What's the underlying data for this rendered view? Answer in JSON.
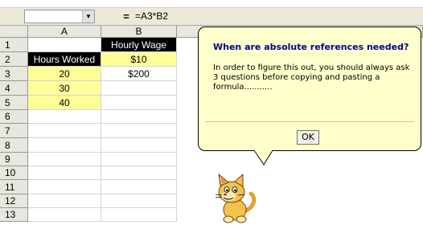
{
  "formula_bar": {
    "name_box_value": "",
    "equals_label": "=",
    "formula": "=A3*B2"
  },
  "grid": {
    "columns": [
      "A",
      "B"
    ],
    "rows": [
      "1",
      "2",
      "3",
      "4",
      "5",
      "6",
      "7",
      "8",
      "9",
      "10",
      "11",
      "12",
      "13"
    ],
    "cells": {
      "B1": "Hourly Wage",
      "A2": "Hours Worked",
      "B2": "$10",
      "A3": "20",
      "B3": "$200",
      "A4": "30",
      "A5": "40"
    }
  },
  "assistant": {
    "title": "When are absolute references needed?",
    "body": "In order to figure this out, you should always ask 3 questions before copying and pasting a formula...........",
    "ok_label": "OK"
  },
  "colors": {
    "balloon_background": "#ffffcc",
    "title_color": "#00008b",
    "highlight_yellow": "#ffff99",
    "header_black": "#000000"
  },
  "icons": {
    "assistant_character": "cat-icon",
    "name_box_dropdown": "chevron-down-icon"
  }
}
